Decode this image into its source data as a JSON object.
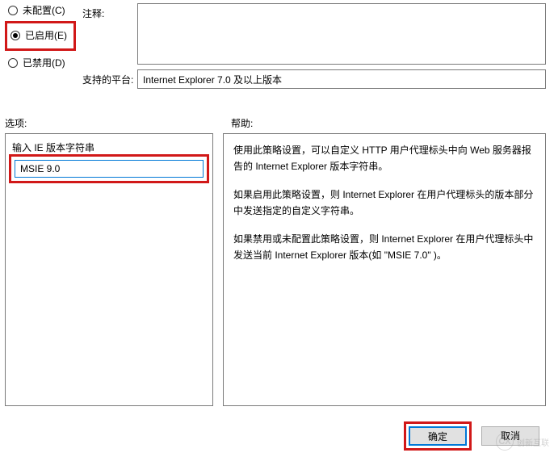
{
  "radios": {
    "not_configured": "未配置(C)",
    "enabled": "已启用(E)",
    "disabled": "已禁用(D)",
    "selected": "enabled"
  },
  "comment": {
    "label": "注释:",
    "value": ""
  },
  "platform": {
    "label": "支持的平台:",
    "value": "Internet Explorer 7.0 及以上版本"
  },
  "options": {
    "section_label": "选项:",
    "input_label": "输入 IE 版本字符串",
    "input_value": "MSIE 9.0"
  },
  "help": {
    "section_label": "帮助:",
    "para1": "使用此策略设置，可以自定义 HTTP 用户代理标头中向 Web 服务器报告的 Internet Explorer 版本字符串。",
    "para2": "如果启用此策略设置，则 Internet Explorer 在用户代理标头的版本部分中发送指定的自定义字符串。",
    "para3": "如果禁用或未配置此策略设置，则 Internet Explorer 在用户代理标头中发送当前 Internet Explorer 版本(如 \"MSIE 7.0\" )。"
  },
  "buttons": {
    "ok": "确定",
    "cancel": "取消"
  },
  "watermark": {
    "text": "创新互联",
    "icon": "CX"
  }
}
